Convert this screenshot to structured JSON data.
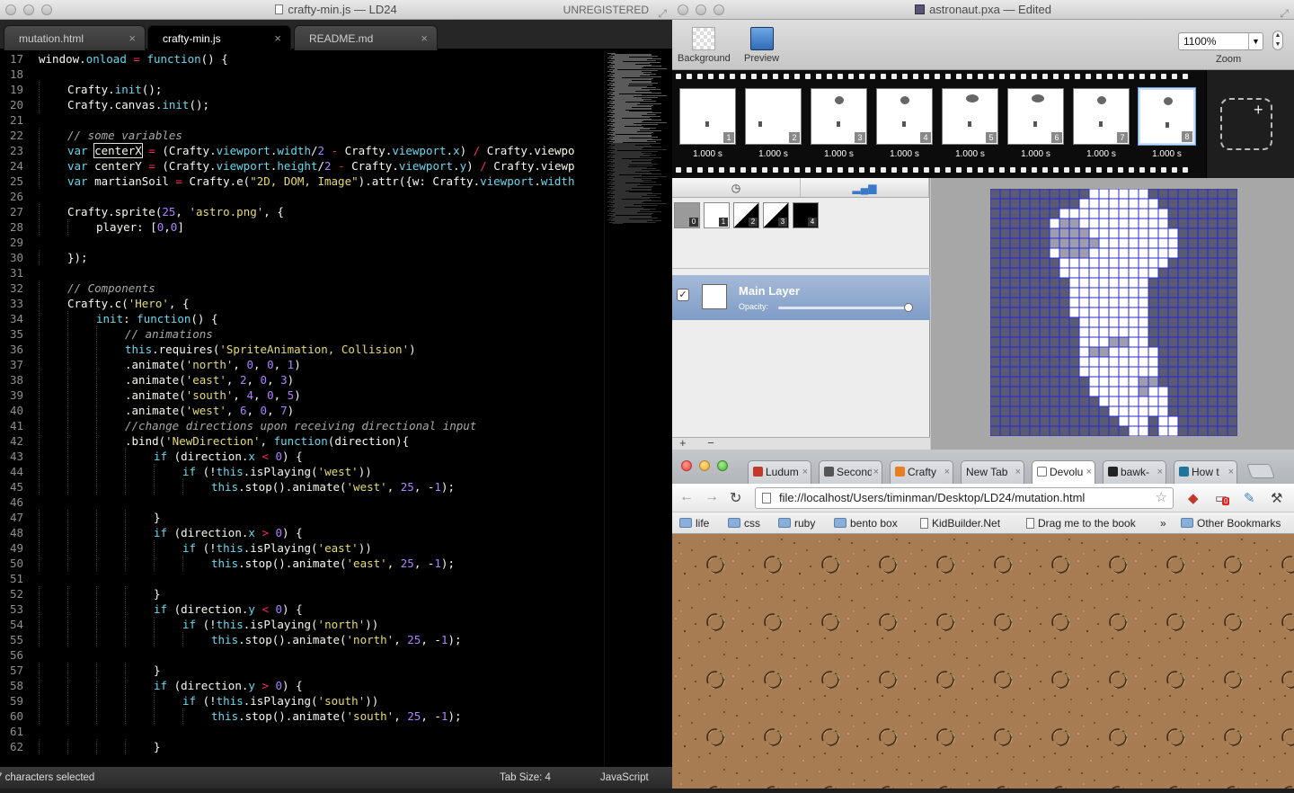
{
  "editor": {
    "window_title": "crafty-min.js — LD24",
    "unregistered": "UNREGISTERED",
    "tabs": [
      {
        "label": "mutation.html"
      },
      {
        "label": "crafty-min.js"
      },
      {
        "label": "README.md"
      }
    ],
    "close_glyph": "×",
    "status": {
      "left": "7 characters selected",
      "tab_size": "Tab Size: 4",
      "syntax": "JavaScript"
    },
    "lines": [
      {
        "n": 17,
        "indent": 0,
        "code": "window.onload = function() {"
      },
      {
        "n": 18,
        "indent": 0,
        "code": ""
      },
      {
        "n": 19,
        "indent": 1,
        "code": "Crafty.init();"
      },
      {
        "n": 20,
        "indent": 1,
        "code": "Crafty.canvas.init();"
      },
      {
        "n": 21,
        "indent": 0,
        "code": ""
      },
      {
        "n": 22,
        "indent": 1,
        "code": "// some variables"
      },
      {
        "n": 23,
        "indent": 1,
        "code": "var centerX = (Crafty.viewport.width/2 - Crafty.viewport.x) / Crafty.viewpo"
      },
      {
        "n": 24,
        "indent": 1,
        "code": "var centerY = (Crafty.viewport.height/2 - Crafty.viewport.y) / Crafty.viewp"
      },
      {
        "n": 25,
        "indent": 1,
        "code": "var martianSoil = Crafty.e(\"2D, DOM, Image\").attr({w: Crafty.viewport.width"
      },
      {
        "n": 26,
        "indent": 0,
        "code": ""
      },
      {
        "n": 27,
        "indent": 1,
        "code": "Crafty.sprite(25, 'astro.png', {"
      },
      {
        "n": 28,
        "indent": 2,
        "code": "player: [0,0]"
      },
      {
        "n": 29,
        "indent": 0,
        "code": ""
      },
      {
        "n": 30,
        "indent": 1,
        "code": "});"
      },
      {
        "n": 31,
        "indent": 0,
        "code": ""
      },
      {
        "n": 32,
        "indent": 1,
        "code": "// Components"
      },
      {
        "n": 33,
        "indent": 1,
        "code": "Crafty.c('Hero', {"
      },
      {
        "n": 34,
        "indent": 2,
        "code": "init: function() {"
      },
      {
        "n": 35,
        "indent": 3,
        "code": "// animations"
      },
      {
        "n": 36,
        "indent": 3,
        "code": "this.requires('SpriteAnimation, Collision')"
      },
      {
        "n": 37,
        "indent": 3,
        "code": ".animate('north', 0, 0, 1)"
      },
      {
        "n": 38,
        "indent": 3,
        "code": ".animate('east', 2, 0, 3)"
      },
      {
        "n": 39,
        "indent": 3,
        "code": ".animate('south', 4, 0, 5)"
      },
      {
        "n": 40,
        "indent": 3,
        "code": ".animate('west', 6, 0, 7)"
      },
      {
        "n": 41,
        "indent": 3,
        "code": "//change directions upon receiving directional input"
      },
      {
        "n": 42,
        "indent": 3,
        "code": ".bind('NewDirection', function(direction){"
      },
      {
        "n": 43,
        "indent": 4,
        "code": "if (direction.x < 0) {"
      },
      {
        "n": 44,
        "indent": 5,
        "code": "if (!this.isPlaying('west'))"
      },
      {
        "n": 45,
        "indent": 6,
        "code": "this.stop().animate('west', 25, -1);"
      },
      {
        "n": 46,
        "indent": 0,
        "code": ""
      },
      {
        "n": 47,
        "indent": 4,
        "code": "}"
      },
      {
        "n": 48,
        "indent": 4,
        "code": "if (direction.x > 0) {"
      },
      {
        "n": 49,
        "indent": 5,
        "code": "if (!this.isPlaying('east'))"
      },
      {
        "n": 50,
        "indent": 6,
        "code": "this.stop().animate('east', 25, -1);"
      },
      {
        "n": 51,
        "indent": 0,
        "code": ""
      },
      {
        "n": 52,
        "indent": 4,
        "code": "}"
      },
      {
        "n": 53,
        "indent": 4,
        "code": "if (direction.y < 0) {"
      },
      {
        "n": 54,
        "indent": 5,
        "code": "if (!this.isPlaying('north'))"
      },
      {
        "n": 55,
        "indent": 6,
        "code": "this.stop().animate('north', 25, -1);"
      },
      {
        "n": 56,
        "indent": 0,
        "code": ""
      },
      {
        "n": 57,
        "indent": 4,
        "code": "}"
      },
      {
        "n": 58,
        "indent": 4,
        "code": "if (direction.y > 0) {"
      },
      {
        "n": 59,
        "indent": 5,
        "code": "if (!this.isPlaying('south'))"
      },
      {
        "n": 60,
        "indent": 6,
        "code": "this.stop().animate('south', 25, -1);"
      },
      {
        "n": 61,
        "indent": 0,
        "code": ""
      },
      {
        "n": 62,
        "indent": 4,
        "code": "}"
      }
    ]
  },
  "pixen": {
    "window_title": "astronaut.pxa — Edited",
    "tools": [
      {
        "label": "Background"
      },
      {
        "label": "Preview"
      }
    ],
    "zoom_value": "1100%",
    "zoom_label": "Zoom",
    "frames": [
      {
        "num": "1",
        "duration": "1.000 s"
      },
      {
        "num": "2",
        "duration": "1.000 s"
      },
      {
        "num": "3",
        "duration": "1.000 s"
      },
      {
        "num": "4",
        "duration": "1.000 s"
      },
      {
        "num": "5",
        "duration": "1.000 s"
      },
      {
        "num": "6",
        "duration": "1.000 s"
      },
      {
        "num": "7",
        "duration": "1.000 s"
      },
      {
        "num": "8",
        "duration": "1.000 s"
      }
    ],
    "selected_frame": 8,
    "swatches": [
      {
        "num": "0"
      },
      {
        "num": "1"
      },
      {
        "num": "2"
      },
      {
        "num": "3"
      },
      {
        "num": "4"
      }
    ],
    "layer": {
      "name": "Main Layer",
      "opacity_label": "Opacity:",
      "opacity": 1.0
    },
    "add_glyph": "+",
    "remove_glyph": "−",
    "colors": {
      "grid": "#2b2bd0",
      "dark": "#5a5a74",
      "white": "#ffffff",
      "mid": "#9d9dae"
    }
  },
  "browser": {
    "tabs": [
      {
        "label": "Ludum",
        "fav": "#c0392b"
      },
      {
        "label": "Second",
        "fav": "#555555"
      },
      {
        "label": "Crafty",
        "fav": "#e67e22"
      },
      {
        "label": "New Tab",
        "fav": ""
      },
      {
        "label": "Devolu",
        "fav": "#ffffff"
      },
      {
        "label": "bawk-",
        "fav": "#222222"
      },
      {
        "label": "How t",
        "fav": "#21759b"
      }
    ],
    "url": "file://localhost/Users/timinman/Desktop/LD24/mutation.html",
    "bookmarks": [
      {
        "label": "life",
        "kind": "folder"
      },
      {
        "label": "css",
        "kind": "folder"
      },
      {
        "label": "ruby",
        "kind": "folder"
      },
      {
        "label": "bento box",
        "kind": "folder"
      },
      {
        "label": "KidBuilder.Net",
        "kind": "page"
      },
      {
        "label": "Drag me to the book",
        "kind": "page"
      }
    ],
    "more_glyph": "»",
    "other_bookmarks": "Other Bookmarks",
    "ext_badge": "0",
    "soil_color": "#a87c52"
  }
}
